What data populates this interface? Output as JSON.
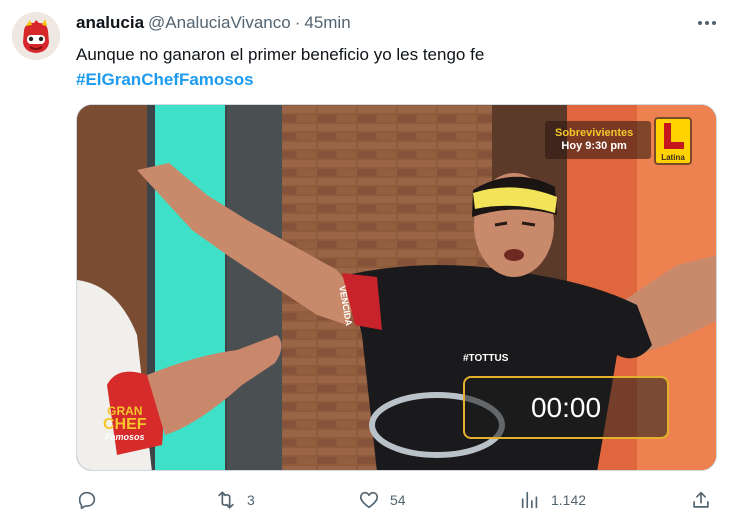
{
  "tweet": {
    "display_name": "analucia",
    "handle": "@AnaluciaVivanco",
    "separator": "·",
    "time": "45min",
    "text": "Aunque no ganaron el primer beneficio yo les tengo fe",
    "hashtag": "#ElGranChefFamosos",
    "avatar_icon": "red-toy-character-avatar",
    "more_icon": "more-horizontal-icon"
  },
  "media": {
    "promo_line1": "Sobrevivientes",
    "promo_line2": "Hoy 9:30 pm",
    "channel_name": "Latina",
    "timer": "00:00",
    "shirt_text": "#TOTTUS",
    "show_logo_line1": "GRAN",
    "show_logo_line2": "CHEF",
    "show_logo_line3": "Famosos",
    "armband_text": "VENCIDA",
    "colors": {
      "brick": "#8c5a3c",
      "teal": "#3fe0c8",
      "headband": "#f3e35a",
      "timer_border": "#e4b12c"
    }
  },
  "actions": {
    "reply_count": "",
    "retweet_count": "3",
    "like_count": "54",
    "views_count": "1.142",
    "share_count": ""
  }
}
